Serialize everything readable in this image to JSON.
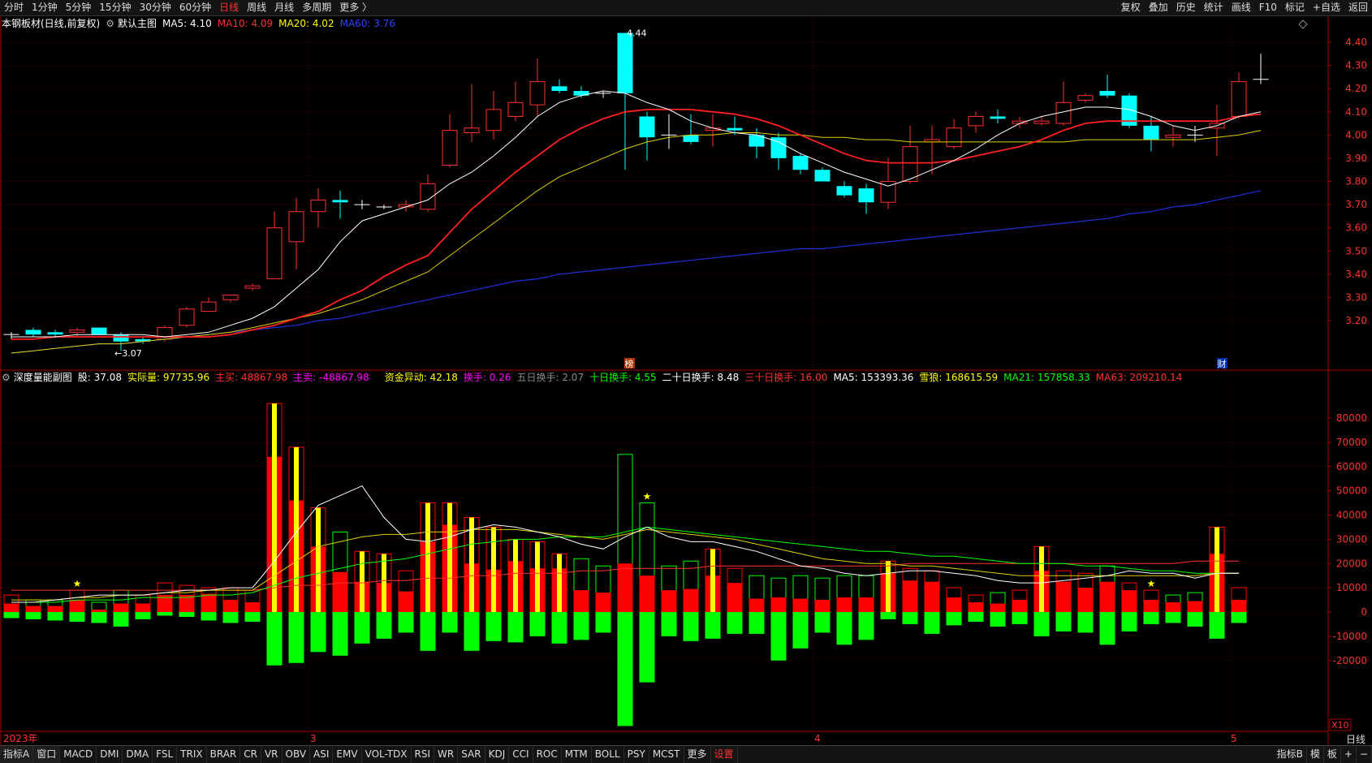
{
  "toolbar": {
    "periods": [
      "分时",
      "1分钟",
      "5分钟",
      "15分钟",
      "30分钟",
      "60分钟",
      "日线",
      "周线",
      "月线",
      "多周期",
      "更多 〉"
    ],
    "active_period": "日线",
    "right_buttons": [
      "复权",
      "叠加",
      "历史",
      "统计",
      "画线",
      "F10",
      "标记",
      "+自选",
      "返回"
    ]
  },
  "main_legend": {
    "stock": "本钢板材(日线,前复权)",
    "template": "默认主图",
    "ma5": "MA5: 4.10",
    "ma10": "MA10: 4.09",
    "ma20": "MA20: 4.02",
    "ma60": "MA60: 3.76"
  },
  "sub_legend": {
    "indicator": "深度量能副图",
    "items": [
      {
        "text": "股: 37.08",
        "color": "#ffffff"
      },
      {
        "text": "实际量: 97735.96",
        "color": "#ffff00"
      },
      {
        "text": "主买: 48867.98",
        "color": "#ff3030"
      },
      {
        "text": "主卖: -48867.98",
        "color": "#ff00ff"
      },
      {
        "text": "资金异动: 42.18",
        "color": "#ffff00"
      },
      {
        "text": "换手: 0.26",
        "color": "#ff00ff"
      },
      {
        "text": "五日换手: 2.07",
        "color": "#888888"
      },
      {
        "text": "十日换手: 4.55",
        "color": "#00ff00"
      },
      {
        "text": "二十日换手: 8.48",
        "color": "#ffffff"
      },
      {
        "text": "三十日换手: 16.00",
        "color": "#ff3030"
      },
      {
        "text": "MA5: 153393.36",
        "color": "#ffffff"
      },
      {
        "text": "雪狼: 168615.59",
        "color": "#ffff00"
      },
      {
        "text": "MA21: 157858.33",
        "color": "#00ff00"
      },
      {
        "text": "MA63: 209210.14",
        "color": "#ff3030"
      }
    ]
  },
  "annotations": {
    "high": "4.44",
    "low": "←3.07",
    "marker_bang": "榜",
    "marker_cai": "财",
    "sub_unit": "X10"
  },
  "colors": {
    "up": "#ff3030",
    "down": "#00ffff",
    "ma5": "#ffffff",
    "ma10": "#ff2020",
    "ma20": "#e0d000",
    "ma60": "#2030e0",
    "vol_yellow": "#ffff00",
    "vol_red": "#ff0000",
    "vol_green": "#00ff00",
    "grid": "#5a0000",
    "axis": "#a00000"
  },
  "chart_data": [
    {
      "type": "candlestick",
      "title": "本钢板材(日线,前复权)",
      "y_ticks": [
        4.4,
        4.3,
        4.2,
        4.1,
        4.0,
        3.9,
        3.8,
        3.7,
        3.6,
        3.5,
        3.4,
        3.3,
        3.2
      ],
      "ylim": [
        3.02,
        4.46
      ],
      "x_labels": [
        {
          "index": 0,
          "text": "2023年"
        },
        {
          "index": 14,
          "text": "3"
        },
        {
          "index": 37,
          "text": "4"
        },
        {
          "index": 56,
          "text": "5"
        }
      ],
      "candles": [
        {
          "o": 3.14,
          "h": 3.15,
          "l": 3.12,
          "c": 3.14
        },
        {
          "o": 3.16,
          "h": 3.17,
          "l": 3.13,
          "c": 3.14
        },
        {
          "o": 3.15,
          "h": 3.16,
          "l": 3.13,
          "c": 3.14
        },
        {
          "o": 3.15,
          "h": 3.17,
          "l": 3.13,
          "c": 3.16
        },
        {
          "o": 3.17,
          "h": 3.17,
          "l": 3.14,
          "c": 3.14
        },
        {
          "o": 3.14,
          "h": 3.15,
          "l": 3.07,
          "c": 3.11
        },
        {
          "o": 3.12,
          "h": 3.13,
          "l": 3.1,
          "c": 3.11
        },
        {
          "o": 3.12,
          "h": 3.18,
          "l": 3.11,
          "c": 3.17
        },
        {
          "o": 3.18,
          "h": 3.26,
          "l": 3.17,
          "c": 3.25
        },
        {
          "o": 3.24,
          "h": 3.3,
          "l": 3.24,
          "c": 3.28
        },
        {
          "o": 3.29,
          "h": 3.31,
          "l": 3.28,
          "c": 3.31
        },
        {
          "o": 3.34,
          "h": 3.36,
          "l": 3.33,
          "c": 3.35
        },
        {
          "o": 3.38,
          "h": 3.67,
          "l": 3.38,
          "c": 3.6
        },
        {
          "o": 3.54,
          "h": 3.73,
          "l": 3.42,
          "c": 3.67
        },
        {
          "o": 3.67,
          "h": 3.77,
          "l": 3.6,
          "c": 3.72
        },
        {
          "o": 3.72,
          "h": 3.76,
          "l": 3.64,
          "c": 3.71
        },
        {
          "o": 3.7,
          "h": 3.72,
          "l": 3.68,
          "c": 3.7
        },
        {
          "o": 3.69,
          "h": 3.7,
          "l": 3.68,
          "c": 3.69
        },
        {
          "o": 3.69,
          "h": 3.72,
          "l": 3.67,
          "c": 3.7
        },
        {
          "o": 3.68,
          "h": 3.83,
          "l": 3.67,
          "c": 3.79
        },
        {
          "o": 3.87,
          "h": 4.09,
          "l": 3.86,
          "c": 4.02
        },
        {
          "o": 4.01,
          "h": 4.22,
          "l": 3.97,
          "c": 4.03
        },
        {
          "o": 4.02,
          "h": 4.19,
          "l": 3.98,
          "c": 4.11
        },
        {
          "o": 4.08,
          "h": 4.23,
          "l": 4.06,
          "c": 4.14
        },
        {
          "o": 4.13,
          "h": 4.33,
          "l": 4.08,
          "c": 4.23
        },
        {
          "o": 4.21,
          "h": 4.24,
          "l": 4.18,
          "c": 4.19
        },
        {
          "o": 4.19,
          "h": 4.21,
          "l": 4.16,
          "c": 4.17
        },
        {
          "o": 4.18,
          "h": 4.19,
          "l": 4.16,
          "c": 4.18
        },
        {
          "o": 4.44,
          "h": 4.44,
          "l": 3.85,
          "c": 4.18
        },
        {
          "o": 4.08,
          "h": 4.1,
          "l": 3.89,
          "c": 3.99
        },
        {
          "o": 4.0,
          "h": 4.09,
          "l": 3.94,
          "c": 4.0
        },
        {
          "o": 4.0,
          "h": 4.09,
          "l": 3.96,
          "c": 3.97
        },
        {
          "o": 4.02,
          "h": 4.09,
          "l": 3.95,
          "c": 4.03
        },
        {
          "o": 4.03,
          "h": 4.08,
          "l": 4.0,
          "c": 4.02
        },
        {
          "o": 4.0,
          "h": 4.03,
          "l": 3.9,
          "c": 3.95
        },
        {
          "o": 3.99,
          "h": 4.01,
          "l": 3.85,
          "c": 3.9
        },
        {
          "o": 3.91,
          "h": 3.92,
          "l": 3.83,
          "c": 3.85
        },
        {
          "o": 3.85,
          "h": 3.86,
          "l": 3.8,
          "c": 3.8
        },
        {
          "o": 3.78,
          "h": 3.8,
          "l": 3.73,
          "c": 3.74
        },
        {
          "o": 3.77,
          "h": 3.79,
          "l": 3.66,
          "c": 3.71
        },
        {
          "o": 3.71,
          "h": 3.9,
          "l": 3.68,
          "c": 3.8
        },
        {
          "o": 3.8,
          "h": 4.04,
          "l": 3.79,
          "c": 3.95
        },
        {
          "o": 3.97,
          "h": 4.04,
          "l": 3.83,
          "c": 3.98
        },
        {
          "o": 3.95,
          "h": 4.07,
          "l": 3.94,
          "c": 4.03
        },
        {
          "o": 4.04,
          "h": 4.1,
          "l": 4.01,
          "c": 4.08
        },
        {
          "o": 4.08,
          "h": 4.11,
          "l": 4.05,
          "c": 4.07
        },
        {
          "o": 4.05,
          "h": 4.08,
          "l": 4.03,
          "c": 4.06
        },
        {
          "o": 4.05,
          "h": 4.08,
          "l": 4.04,
          "c": 4.06
        },
        {
          "o": 4.05,
          "h": 4.23,
          "l": 4.04,
          "c": 4.14
        },
        {
          "o": 4.15,
          "h": 4.18,
          "l": 4.14,
          "c": 4.17
        },
        {
          "o": 4.19,
          "h": 4.26,
          "l": 4.16,
          "c": 4.17
        },
        {
          "o": 4.17,
          "h": 4.18,
          "l": 4.03,
          "c": 4.04
        },
        {
          "o": 4.04,
          "h": 4.08,
          "l": 3.93,
          "c": 3.98
        },
        {
          "o": 3.99,
          "h": 4.04,
          "l": 3.95,
          "c": 4.0
        },
        {
          "o": 4.0,
          "h": 4.04,
          "l": 3.97,
          "c": 4.0
        },
        {
          "o": 4.03,
          "h": 4.13,
          "l": 3.91,
          "c": 4.05
        },
        {
          "o": 4.08,
          "h": 4.27,
          "l": 4.07,
          "c": 4.23
        },
        {
          "o": 4.24,
          "h": 4.35,
          "l": 4.22,
          "c": 4.24
        }
      ],
      "ma": {
        "ma5": [
          3.13,
          3.13,
          3.13,
          3.14,
          3.14,
          3.14,
          3.14,
          3.13,
          3.14,
          3.15,
          3.18,
          3.21,
          3.26,
          3.34,
          3.42,
          3.54,
          3.63,
          3.66,
          3.69,
          3.72,
          3.79,
          3.84,
          3.91,
          3.99,
          4.08,
          4.14,
          4.17,
          4.19,
          4.18,
          4.14,
          4.11,
          4.06,
          4.03,
          4.01,
          4.0,
          3.97,
          3.92,
          3.88,
          3.84,
          3.81,
          3.78,
          3.81,
          3.85,
          3.89,
          3.94,
          4.0,
          4.05,
          4.08,
          4.1,
          4.12,
          4.12,
          4.11,
          4.08,
          4.04,
          4.02,
          4.04,
          4.08,
          4.1
        ],
        "ma10": [
          3.12,
          3.12,
          3.13,
          3.13,
          3.13,
          3.13,
          3.13,
          3.13,
          3.13,
          3.13,
          3.14,
          3.16,
          3.18,
          3.21,
          3.24,
          3.29,
          3.33,
          3.39,
          3.44,
          3.48,
          3.58,
          3.68,
          3.76,
          3.84,
          3.91,
          3.98,
          4.03,
          4.07,
          4.1,
          4.11,
          4.11,
          4.11,
          4.1,
          4.09,
          4.07,
          4.04,
          4.0,
          3.96,
          3.92,
          3.89,
          3.88,
          3.88,
          3.88,
          3.89,
          3.91,
          3.93,
          3.95,
          3.98,
          4.02,
          4.05,
          4.06,
          4.06,
          4.06,
          4.06,
          4.06,
          4.06,
          4.08,
          4.09
        ],
        "ma20": [
          3.06,
          3.07,
          3.08,
          3.09,
          3.1,
          3.1,
          3.11,
          3.12,
          3.13,
          3.14,
          3.15,
          3.17,
          3.19,
          3.21,
          3.23,
          3.26,
          3.29,
          3.33,
          3.37,
          3.41,
          3.48,
          3.55,
          3.62,
          3.69,
          3.76,
          3.82,
          3.86,
          3.9,
          3.94,
          3.97,
          3.99,
          4.0,
          4.0,
          4.01,
          4.01,
          4.0,
          4.0,
          3.99,
          3.99,
          3.98,
          3.98,
          3.97,
          3.97,
          3.97,
          3.97,
          3.97,
          3.97,
          3.97,
          3.97,
          3.98,
          3.98,
          3.98,
          3.98,
          3.98,
          3.98,
          3.99,
          4.0,
          4.02
        ],
        "ma60": [
          3.06,
          3.07,
          3.08,
          3.09,
          3.1,
          3.1,
          3.11,
          3.12,
          3.13,
          3.14,
          3.15,
          3.16,
          3.17,
          3.18,
          3.2,
          3.21,
          3.23,
          3.25,
          3.27,
          3.29,
          3.31,
          3.33,
          3.35,
          3.37,
          3.38,
          3.4,
          3.41,
          3.42,
          3.43,
          3.44,
          3.45,
          3.46,
          3.47,
          3.48,
          3.49,
          3.5,
          3.51,
          3.51,
          3.52,
          3.53,
          3.54,
          3.55,
          3.56,
          3.57,
          3.58,
          3.59,
          3.6,
          3.61,
          3.62,
          3.63,
          3.64,
          3.66,
          3.67,
          3.69,
          3.7,
          3.72,
          3.74,
          3.76
        ]
      }
    },
    {
      "type": "bar",
      "title": "深度量能副图",
      "y_ticks": [
        80000,
        70000,
        60000,
        50000,
        40000,
        30000,
        20000,
        10000,
        0,
        -10000,
        -20000
      ],
      "ylim": [
        -28000,
        88000
      ],
      "volume": [
        7000,
        5000,
        5000,
        9000,
        4000,
        9000,
        7000,
        12000,
        11000,
        10000,
        10000,
        9000,
        86000,
        68000,
        43000,
        33000,
        25000,
        24000,
        17000,
        45000,
        45000,
        39000,
        35000,
        30000,
        29000,
        24000,
        22000,
        19000,
        65000,
        45000,
        19000,
        21000,
        26000,
        18000,
        15000,
        14000,
        15000,
        14000,
        15000,
        15000,
        21000,
        18000,
        17000,
        10000,
        7000,
        8000,
        9000,
        27000,
        17000,
        16000,
        19000,
        12000,
        9000,
        7000,
        8000,
        35000,
        10000
      ],
      "buy": [
        3500,
        2500,
        2500,
        5000,
        1000,
        3500,
        3500,
        7000,
        7000,
        7500,
        5000,
        4000,
        64000,
        46000,
        27000,
        16500,
        12500,
        12000,
        8500,
        29000,
        36000,
        20000,
        17500,
        21000,
        18000,
        18000,
        9000,
        8000,
        20000,
        15000,
        9000,
        9500,
        15000,
        12000,
        5500,
        6000,
        5500,
        5000,
        6000,
        6000,
        16000,
        13000,
        12500,
        6000,
        4000,
        3500,
        5000,
        17000,
        12500,
        10000,
        12500,
        9000,
        5000,
        4000,
        4500,
        24000,
        5000
      ],
      "sell": [
        -2500,
        -3000,
        -3500,
        -4000,
        -4500,
        -6000,
        -3000,
        -1500,
        -2000,
        -3500,
        -4500,
        -4000,
        -22000,
        -21000,
        -16500,
        -18000,
        -13000,
        -11000,
        -8500,
        -16000,
        -8500,
        -16000,
        -12000,
        -12500,
        -10000,
        -13000,
        -11500,
        -8500,
        -47000,
        -29000,
        -10000,
        -12000,
        -11000,
        -9000,
        -9000,
        -20000,
        -15000,
        -8500,
        -13500,
        -11500,
        -3000,
        -5000,
        -9000,
        -5500,
        -4000,
        -6000,
        -5000,
        -10000,
        -8000,
        -8500,
        -13500,
        -8000,
        -5000,
        -4500,
        -6000,
        -11000,
        -4500
      ],
      "ma5": [
        4000,
        4000,
        5000,
        6000,
        7000,
        7000,
        7000,
        8000,
        9000,
        9000,
        10000,
        10000,
        21000,
        33000,
        44000,
        48000,
        52000,
        39000,
        30000,
        29000,
        31000,
        34000,
        36000,
        35000,
        33000,
        31000,
        28000,
        26000,
        31000,
        35000,
        31000,
        29000,
        29000,
        27000,
        25000,
        22000,
        19000,
        18000,
        16000,
        15000,
        16000,
        17000,
        17000,
        16000,
        15000,
        13000,
        12000,
        12000,
        13000,
        14000,
        15000,
        17000,
        16000,
        16000,
        14000,
        16000,
        16000
      ],
      "xuelang": [
        5000,
        5000,
        5000,
        6000,
        6000,
        7000,
        7000,
        8000,
        8000,
        9000,
        9000,
        9000,
        15000,
        21000,
        27000,
        29000,
        31000,
        32000,
        32000,
        33000,
        33000,
        34000,
        34000,
        34000,
        33000,
        32000,
        31000,
        30000,
        32000,
        34000,
        33000,
        32000,
        31000,
        30000,
        28000,
        26000,
        24000,
        22000,
        21000,
        20000,
        20000,
        19000,
        19000,
        18000,
        17000,
        16000,
        15000,
        15000,
        15000,
        15000,
        15000,
        15000,
        15000,
        15000,
        15000,
        16000,
        16000
      ],
      "ma21": [
        4000,
        4000,
        4000,
        5000,
        5000,
        5000,
        6000,
        6000,
        6000,
        7000,
        7000,
        8000,
        11000,
        14000,
        16000,
        18000,
        20000,
        21000,
        22000,
        24000,
        26000,
        28000,
        29000,
        30000,
        30000,
        31000,
        31000,
        31000,
        33000,
        35000,
        34000,
        33000,
        32000,
        31000,
        30000,
        29000,
        28000,
        27000,
        26000,
        25000,
        25000,
        24000,
        23000,
        23000,
        22000,
        21000,
        20000,
        20000,
        20000,
        19000,
        19000,
        18000,
        17000,
        17000,
        16000,
        16000,
        16000
      ],
      "ma63": [
        9000,
        9000,
        9000,
        9000,
        9000,
        9000,
        9000,
        9000,
        9000,
        9000,
        9000,
        9000,
        10000,
        11000,
        11000,
        12000,
        12000,
        13000,
        13000,
        14000,
        14000,
        15000,
        15000,
        16000,
        16000,
        16000,
        17000,
        17000,
        18000,
        18000,
        18000,
        18000,
        19000,
        19000,
        19000,
        19000,
        19000,
        19000,
        19000,
        19000,
        19000,
        20000,
        20000,
        20000,
        20000,
        20000,
        20000,
        20000,
        20000,
        20000,
        20000,
        20000,
        20000,
        20000,
        21000,
        21000,
        21000
      ],
      "stars": [
        3,
        29,
        52
      ]
    }
  ]
}
